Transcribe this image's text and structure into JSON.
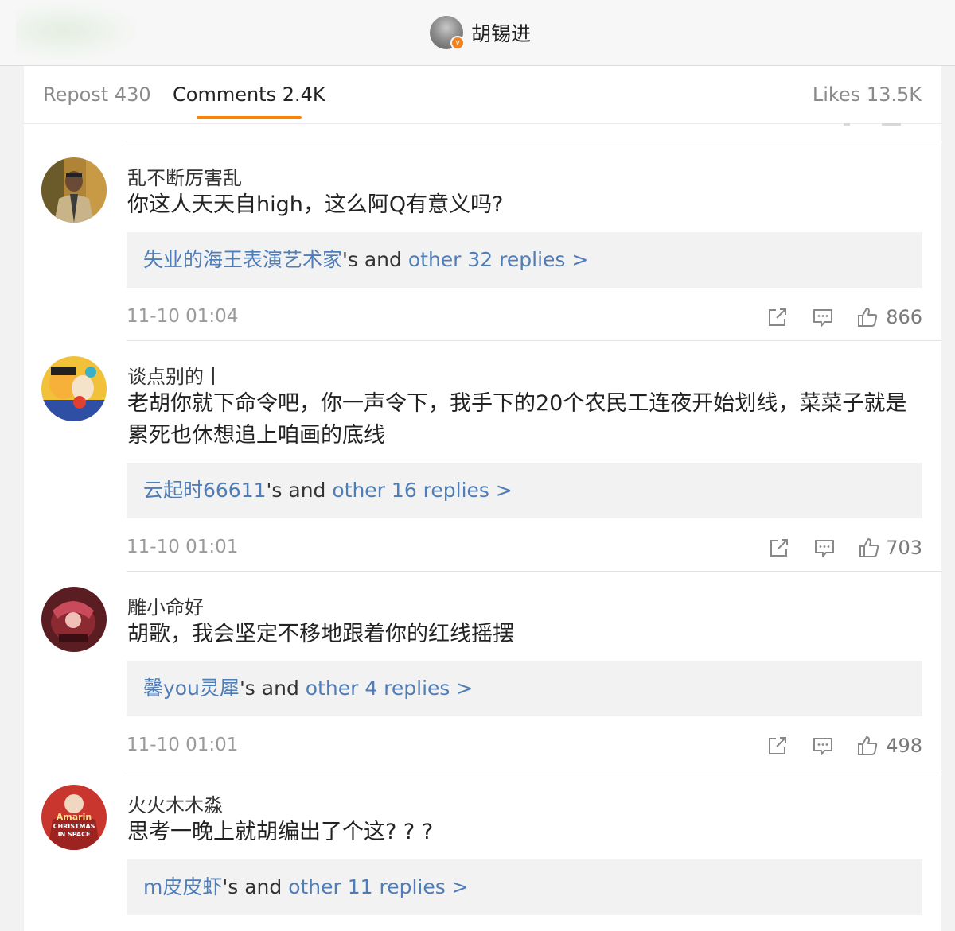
{
  "header": {
    "title": "胡锡进"
  },
  "tabs": [
    {
      "label": "Repost 430"
    },
    {
      "label": "Comments 2.4K"
    },
    {
      "label": "Likes 13.5K"
    }
  ],
  "icons": {
    "share": "share-icon",
    "comment": "comment-icon",
    "like": "thumbs-up-icon",
    "verified": "verified-badge-icon"
  },
  "colors": {
    "accent": "#ff8200",
    "link": "#4f7db8",
    "verified": "#f08321"
  },
  "comments": [
    {
      "user": "乱不断厉害乱",
      "text": "你这人天天自high，这么阿Q有意义吗?",
      "reply_user": "失业的海王表演艺术家",
      "reply_mid": "'s and ",
      "reply_more": "other 32 replies >",
      "time": "11-10 01:04",
      "likes": "866"
    },
    {
      "user": "谈点别的丨",
      "text": "老胡你就下命令吧，你一声令下，我手下的20个农民工连夜开始划线，菜菜子就是累死也休想追上咱画的底线",
      "reply_user": "云起时66611",
      "reply_mid": "'s and ",
      "reply_more": "other 16 replies >",
      "time": "11-10 01:01",
      "likes": "703"
    },
    {
      "user": "雕小命好",
      "text": "胡歌，我会坚定不移地跟着你的红线摇摆",
      "reply_user": "馨you灵犀",
      "reply_mid": "'s and ",
      "reply_more": "other 4 replies >",
      "time": "11-10 01:01",
      "likes": "498"
    },
    {
      "user": "火火木木淼",
      "text": "思考一晚上就胡编出了个这? ? ?",
      "reply_user": "m皮皮虾",
      "reply_mid": "'s and ",
      "reply_more": "other 11 replies >",
      "avatar_text_1": "Amarin",
      "avatar_text_2": "CHRISTMAS",
      "avatar_text_3": "IN SPACE"
    }
  ]
}
